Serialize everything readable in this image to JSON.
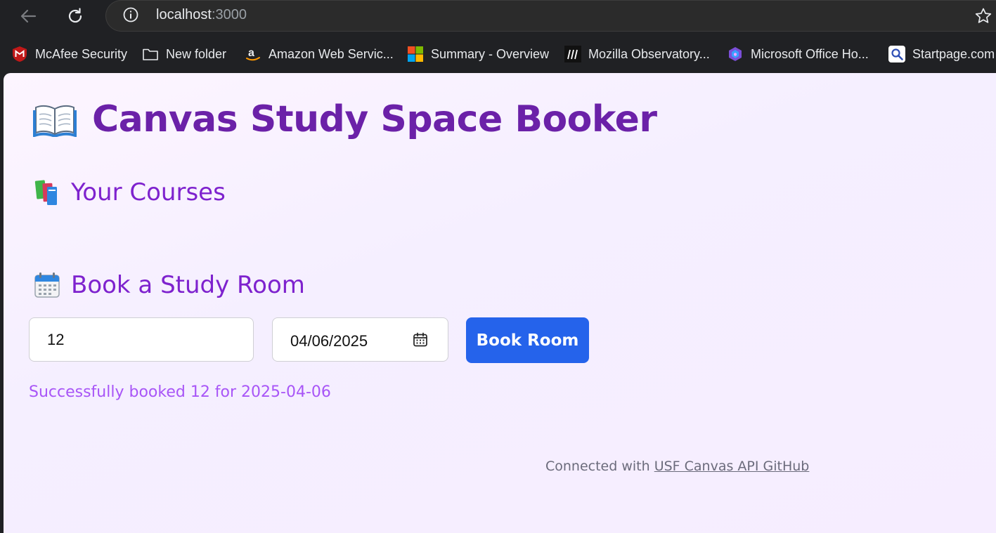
{
  "browser": {
    "url_host": "localhost",
    "url_port": ":3000",
    "bookmarks": [
      {
        "label": "McAfee Security",
        "icon": "mcafee-icon"
      },
      {
        "label": "New folder",
        "icon": "folder-icon"
      },
      {
        "label": "Amazon Web Servic...",
        "icon": "amazon-icon"
      },
      {
        "label": "Summary - Overview",
        "icon": "microsoft-logo-icon"
      },
      {
        "label": "Mozilla Observatory...",
        "icon": "mozilla-observatory-icon"
      },
      {
        "label": "Microsoft Office Ho...",
        "icon": "office-icon"
      },
      {
        "label": "Startpage.com",
        "icon": "startpage-icon"
      }
    ]
  },
  "page": {
    "title": "Canvas Study Space Booker",
    "title_icon": "open-book-icon",
    "courses_heading": "Your Courses",
    "courses_icon": "books-icon",
    "book_heading": "Book a Study Room",
    "book_icon": "calendar-icon",
    "room_value": "12",
    "date_value": "04/06/2025",
    "book_button": "Book Room",
    "success_message": "Successfully booked 12 for 2025-04-06",
    "footer_prefix": "Connected with ",
    "footer_link": "USF Canvas API GitHub"
  },
  "colors": {
    "title": "#6b21a8",
    "heading": "#7e22ce",
    "button": "#2563eb",
    "success": "#a855f7"
  }
}
